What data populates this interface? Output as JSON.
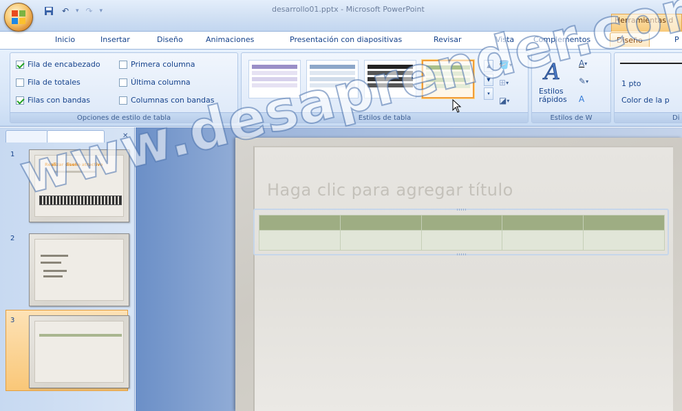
{
  "window": {
    "title": "desarrollo01.pptx - Microsoft PowerPoint",
    "context_tab_group": "Herramientas d"
  },
  "tabs": [
    {
      "label": "Inicio"
    },
    {
      "label": "Insertar"
    },
    {
      "label": "Diseño"
    },
    {
      "label": "Animaciones"
    },
    {
      "label": "Presentación con diapositivas"
    },
    {
      "label": "Revisar"
    },
    {
      "label": "Vista"
    },
    {
      "label": "Complementos"
    },
    {
      "label": "Diseño",
      "active": true
    },
    {
      "label": "P"
    }
  ],
  "ribbon": {
    "table_style_options": {
      "label": "Opciones de estilo de tabla",
      "options": [
        {
          "label": "Fila de encabezado",
          "checked": true
        },
        {
          "label": "Fila de totales",
          "checked": false
        },
        {
          "label": "Filas con bandas",
          "checked": true
        },
        {
          "label": "Primera columna",
          "checked": false
        },
        {
          "label": "Última columna",
          "checked": false
        },
        {
          "label": "Columnas con bandas",
          "checked": false
        }
      ]
    },
    "table_styles": {
      "label": "Estilos de tabla",
      "selected_index": 3
    },
    "wordart": {
      "quick_styles_label": "Estilos rápidos",
      "group_label": "Estilos de W"
    },
    "draw_borders": {
      "pen_weight": "1 pto",
      "pen_color": "Color de la p",
      "group_label": "Di"
    }
  },
  "slides": [
    {
      "number": "1",
      "title": "Realizar diseño atractivo"
    },
    {
      "number": "2"
    },
    {
      "number": "3",
      "selected": true
    }
  ],
  "slide": {
    "title_placeholder": "Haga clic para agregar título"
  },
  "watermark": "www.desaprender.com",
  "colors": {
    "accent_orange": "#f29d38",
    "table_header": "#9ead83",
    "table_band": "#e1e6d8",
    "ribbon_text": "#15428b"
  }
}
